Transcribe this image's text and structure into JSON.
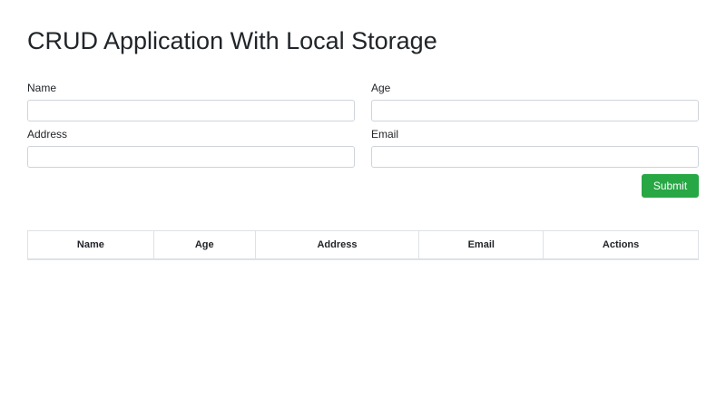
{
  "page": {
    "title": "CRUD Application With Local Storage"
  },
  "form": {
    "name_label": "Name",
    "name_value": "",
    "age_label": "Age",
    "age_value": "",
    "address_label": "Address",
    "address_value": "",
    "email_label": "Email",
    "email_value": "",
    "submit_label": "Submit"
  },
  "table": {
    "headers": [
      "Name",
      "Age",
      "Address",
      "Email",
      "Actions"
    ],
    "rows": []
  },
  "colors": {
    "submit_button": "#28a745",
    "border": "#dee2e6",
    "input_border": "#ced4da"
  }
}
